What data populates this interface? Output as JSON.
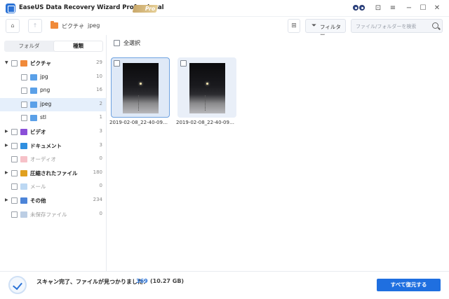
{
  "app": {
    "title": "EaseUS Data Recovery Wizard Professional",
    "badge": "Pro",
    "window_controls": [
      "shirt-icon",
      "minimize-icon",
      "maximize-icon",
      "close-icon"
    ]
  },
  "toolbar": {
    "breadcrumb": [
      "ピクチャ",
      "jpeg"
    ],
    "filter_label": "フィルター",
    "search_placeholder": "ファイル/フォルダーを検索"
  },
  "sidebar": {
    "tabs": [
      "フォルダ",
      "種類"
    ],
    "active_tab": "種類",
    "tree": [
      {
        "label": "ピクチャ",
        "count": "29",
        "bold": true,
        "expanded": true,
        "icon": "pictures-folder-icon",
        "color": "#f08a3a"
      },
      {
        "label": "jpg",
        "count": "10",
        "child": true,
        "icon": "folder-icon",
        "color": "#5aa0e8"
      },
      {
        "label": "png",
        "count": "16",
        "child": true,
        "icon": "folder-icon",
        "color": "#5aa0e8"
      },
      {
        "label": "jpeg",
        "count": "2",
        "child": true,
        "selected": true,
        "icon": "folder-icon",
        "color": "#5aa0e8"
      },
      {
        "label": "stl",
        "count": "1",
        "child": true,
        "icon": "folder-icon",
        "color": "#5aa0e8"
      },
      {
        "label": "ビデオ",
        "count": "3",
        "bold": true,
        "icon": "video-icon",
        "color": "#8a4fd8"
      },
      {
        "label": "ドキュメント",
        "count": "3",
        "bold": true,
        "icon": "document-icon",
        "color": "#2f8fe0"
      },
      {
        "label": "オーディオ",
        "count": "0",
        "dim": true,
        "icon": "audio-icon",
        "color": "#f2a6b0"
      },
      {
        "label": "圧縮されたファイル",
        "count": "180",
        "bold": true,
        "icon": "archive-icon",
        "color": "#e0a020"
      },
      {
        "label": "メール",
        "count": "0",
        "dim": true,
        "icon": "mail-icon",
        "color": "#9fc7ee"
      },
      {
        "label": "その他",
        "count": "234",
        "bold": true,
        "icon": "folder-icon",
        "color": "#4c84d8"
      },
      {
        "label": "未保存ファイル",
        "count": "0",
        "dim": true,
        "icon": "unsaved-file-icon",
        "color": "#9fb9d8"
      }
    ]
  },
  "main": {
    "select_all_label": "全選択",
    "files": [
      {
        "name": "2019-02-08_22-40-09…",
        "focused": true
      },
      {
        "name": "2019-02-08_22-40-09…",
        "focused": false
      }
    ]
  },
  "status": {
    "text": "スキャン完了、ファイルが見つかりました：",
    "count": "369",
    "size": "(10.27 GB)",
    "recover_label": "すべて復元する"
  }
}
